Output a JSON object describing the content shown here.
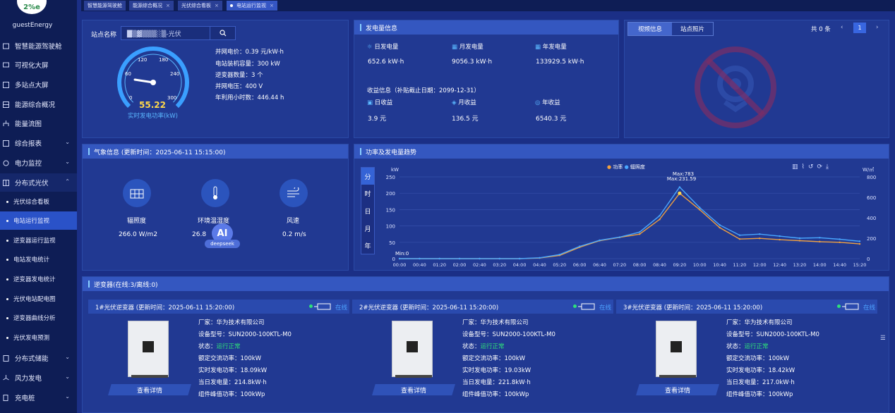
{
  "sidebar": {
    "username": "guestEnergy",
    "items": [
      {
        "label": "智慧能源驾驶舱",
        "icon": "dashboard-icon"
      },
      {
        "label": "可视化大屏",
        "icon": "screen-icon"
      },
      {
        "label": "多站点大屏",
        "icon": "multi-screen-icon"
      },
      {
        "label": "能源综合概况",
        "icon": "overview-icon"
      },
      {
        "label": "能量流图",
        "icon": "flow-icon"
      },
      {
        "label": "综合报表",
        "icon": "report-icon"
      },
      {
        "label": "电力监控",
        "icon": "power-monitor-icon"
      },
      {
        "label": "分布式光伏",
        "icon": "solar-icon"
      }
    ],
    "subitems": [
      "光伏综合看板",
      "电站运行监视",
      "逆变器运行监视",
      "电站发电统计",
      "逆变器发电统计",
      "光伏电站配电图",
      "逆变器曲线分析",
      "光伏发电预测"
    ],
    "bottom": [
      {
        "label": "分布式储能",
        "icon": "storage-icon"
      },
      {
        "label": "风力发电",
        "icon": "wind-power-icon"
      },
      {
        "label": "充电桩",
        "icon": "charger-icon"
      }
    ]
  },
  "tabs": [
    "智慧能源驾驶舱",
    "能源综合概况",
    "光伏综合看板",
    "电站运行监视"
  ],
  "station": {
    "label": "站点名称",
    "value": "█▒▓▒▒▒░▒-光伏",
    "gauge_value": "55.22",
    "gauge_caption": "实时发电功率(kW)",
    "gauge_ticks": [
      "0",
      "60",
      "120",
      "180",
      "240",
      "300"
    ],
    "info": [
      "并网电价：0.39 元/kW·h",
      "电站装机容量：300 kW",
      "逆变器数量：3 个",
      "并网电压：400 V",
      "年利用小时数：446.44 h"
    ]
  },
  "generation": {
    "title": "发电量信息",
    "daily_label": "日发电量",
    "daily": "652.6 kW·h",
    "monthly_label": "月发电量",
    "monthly": "9056.3 kW·h",
    "yearly_label": "年发电量",
    "yearly": "133929.5 kW·h",
    "income_title": "收益信息（补贴截止日期：2099-12-31）",
    "d_inc_label": "日收益",
    "d_inc": "3.9 元",
    "m_inc_label": "月收益",
    "m_inc": "136.5 元",
    "y_inc_label": "年收益",
    "y_inc": "6540.3 元"
  },
  "video": {
    "tab1": "视频信息",
    "tab2": "站点照片",
    "total": "共 0 条",
    "page": "1"
  },
  "weather": {
    "title": "气象信息 (更新时间：2025-06-11 15:15:00)",
    "irr_label": "辐照度",
    "irr": "266.0 W/m2",
    "temp_label": "环境温湿度",
    "temp": "26.8",
    "wind_label": "风速",
    "wind": "0.2 m/s"
  },
  "ai": {
    "badge": "AI",
    "sub": "deepseek"
  },
  "trend": {
    "title": "功率及发电量趋势",
    "periods": [
      "分",
      "时",
      "日",
      "月",
      "年"
    ],
    "legend_power": "功率",
    "legend_irr": "辐照度",
    "ylabel_left": "kW",
    "ylabel_right": "W/㎡",
    "max1": "Max:783",
    "max2": "Max:231.59",
    "min": "Min:0"
  },
  "chart_data": {
    "type": "line",
    "x": [
      "00:00",
      "00:40",
      "01:20",
      "02:00",
      "02:40",
      "03:20",
      "04:00",
      "04:40",
      "05:20",
      "06:00",
      "06:40",
      "07:20",
      "08:00",
      "08:40",
      "09:20",
      "10:00",
      "10:40",
      "11:20",
      "12:00",
      "12:40",
      "13:20",
      "14:00",
      "14:40",
      "15:20"
    ],
    "ylim": [
      0,
      250
    ],
    "y2lim": [
      0,
      800
    ],
    "y_ticks": [
      "0",
      "50",
      "100",
      "150",
      "200",
      "250"
    ],
    "y2_ticks": [
      "0",
      "200",
      "400",
      "600",
      "800"
    ],
    "series": [
      {
        "name": "功率",
        "color": "#f0a040",
        "values": [
          0,
          0,
          0,
          0,
          0,
          0,
          0,
          2,
          10,
          35,
          55,
          65,
          75,
          120,
          200,
          150,
          95,
          60,
          62,
          58,
          55,
          52,
          50,
          45
        ]
      },
      {
        "name": "辐照度",
        "color": "#49a7ff",
        "values": [
          0,
          0,
          0,
          0,
          0,
          0,
          0,
          8,
          40,
          120,
          180,
          210,
          260,
          420,
          700,
          500,
          330,
          230,
          240,
          220,
          200,
          205,
          190,
          170
        ]
      }
    ]
  },
  "inverters": {
    "title": "逆变器(在线:3/离线:0)",
    "status_online": "在线",
    "detail": "查看详情",
    "items": [
      {
        "name": "1#光伏逆变器 (更新时间：2025-06-11 15:20:00)",
        "vendor": "厂家：华为技术有限公司",
        "model": "设备型号：SUN2000-100KTL-M0",
        "state_label": "状态：",
        "state": "运行正常",
        "rated": "额定交流功率：100kW",
        "realtime": "实时发电功率：18.09kW",
        "today": "当日发电量：214.8kW·h",
        "peak": "组件峰值功率：100kWp"
      },
      {
        "name": "2#光伏逆变器 (更新时间：2025-06-11 15:20:00)",
        "vendor": "厂家：华为技术有限公司",
        "model": "设备型号：SUN2000-100KTL-M0",
        "state_label": "状态：",
        "state": "运行正常",
        "rated": "额定交流功率：100kW",
        "realtime": "实时发电功率：19.03kW",
        "today": "当日发电量：221.8kW·h",
        "peak": "组件峰值功率：100kWp"
      },
      {
        "name": "3#光伏逆变器 (更新时间：2025-06-11 15:20:00)",
        "vendor": "厂家：华为技术有限公司",
        "model": "设备型号：SUN2000-100KTL-M0",
        "state_label": "状态：",
        "state": "运行正常",
        "rated": "额定交流功率：100kW",
        "realtime": "实时发电功率：18.42kW",
        "today": "当日发电量：217.0kW·h",
        "peak": "组件峰值功率：100kWp"
      }
    ]
  }
}
